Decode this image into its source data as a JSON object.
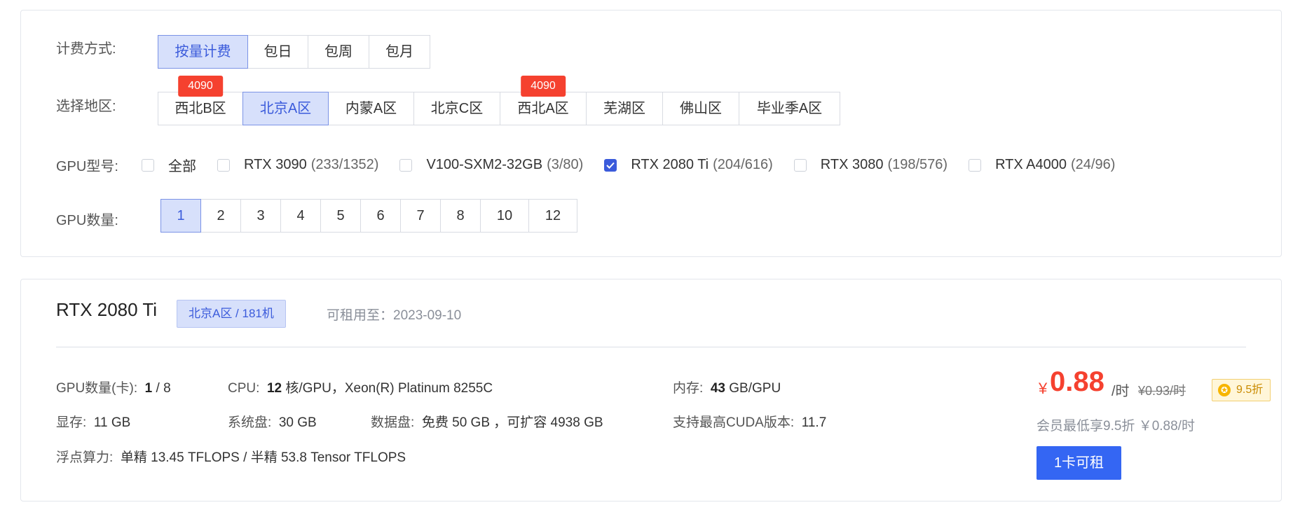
{
  "filters": {
    "billing": {
      "label": "计费方式:",
      "options": [
        "按量计费",
        "包日",
        "包周",
        "包月"
      ],
      "selected": "按量计费"
    },
    "region": {
      "label": "选择地区:",
      "options": [
        {
          "name": "西北B区",
          "tag": "4090"
        },
        {
          "name": "北京A区",
          "tag": ""
        },
        {
          "name": "内蒙A区",
          "tag": ""
        },
        {
          "name": "北京C区",
          "tag": ""
        },
        {
          "name": "西北A区",
          "tag": "4090"
        },
        {
          "name": "芜湖区",
          "tag": ""
        },
        {
          "name": "佛山区",
          "tag": ""
        },
        {
          "name": "毕业季A区",
          "tag": ""
        }
      ],
      "selected": "北京A区"
    },
    "gpu_model": {
      "label": "GPU型号:",
      "options": [
        {
          "name": "全部",
          "count": "",
          "checked": false
        },
        {
          "name": "RTX 3090",
          "count": "(233/1352)",
          "checked": false
        },
        {
          "name": "V100-SXM2-32GB",
          "count": "(3/80)",
          "checked": false
        },
        {
          "name": "RTX 2080 Ti",
          "count": "(204/616)",
          "checked": true
        },
        {
          "name": "RTX 3080",
          "count": "(198/576)",
          "checked": false
        },
        {
          "name": "RTX A4000",
          "count": "(24/96)",
          "checked": false
        }
      ]
    },
    "gpu_count": {
      "label": "GPU数量:",
      "options": [
        "1",
        "2",
        "3",
        "4",
        "5",
        "6",
        "7",
        "8",
        "10",
        "12"
      ],
      "selected": "1"
    }
  },
  "result": {
    "gpu_name": "RTX 2080 Ti",
    "region_badge": "北京A区 / 181机",
    "available_until": "可租用至：2023-09-10",
    "specs": {
      "gpu_count_label": "GPU数量(卡):",
      "gpu_count_value": "1",
      "gpu_count_total": " / 8",
      "cpu_label": "CPU:",
      "cpu_cores": "12",
      "cpu_rest": "核/GPU，Xeon(R) Platinum 8255C",
      "mem_label": "内存:",
      "mem_value": "43",
      "mem_unit": "GB/GPU",
      "vram_label": "显存:",
      "vram_value": "11 GB",
      "sysdisk_label": "系统盘:",
      "sysdisk_value": "30 GB",
      "datadisk_label": "数据盘:",
      "datadisk_value": "免费 50 GB ，可扩容 4938 GB",
      "cuda_label": "支持最高CUDA版本:",
      "cuda_value": "11.7",
      "flops_label": "浮点算力:",
      "flops_value": "单精 13.45 TFLOPS / 半精 53.8 Tensor TFLOPS"
    },
    "price": {
      "currency": "¥",
      "value": "0.88",
      "unit": "/时",
      "original": "¥0.93/时",
      "discount": "9.5折",
      "member_note": "会员最低享9.5折 ￥0.88/时"
    },
    "rent_button": "1卡可租"
  },
  "colors": {
    "accent": "#3b5bdb",
    "button": "#3466f3",
    "price": "#f5412f",
    "tag": "#f5412f",
    "active_bg": "#d7e0fb"
  }
}
